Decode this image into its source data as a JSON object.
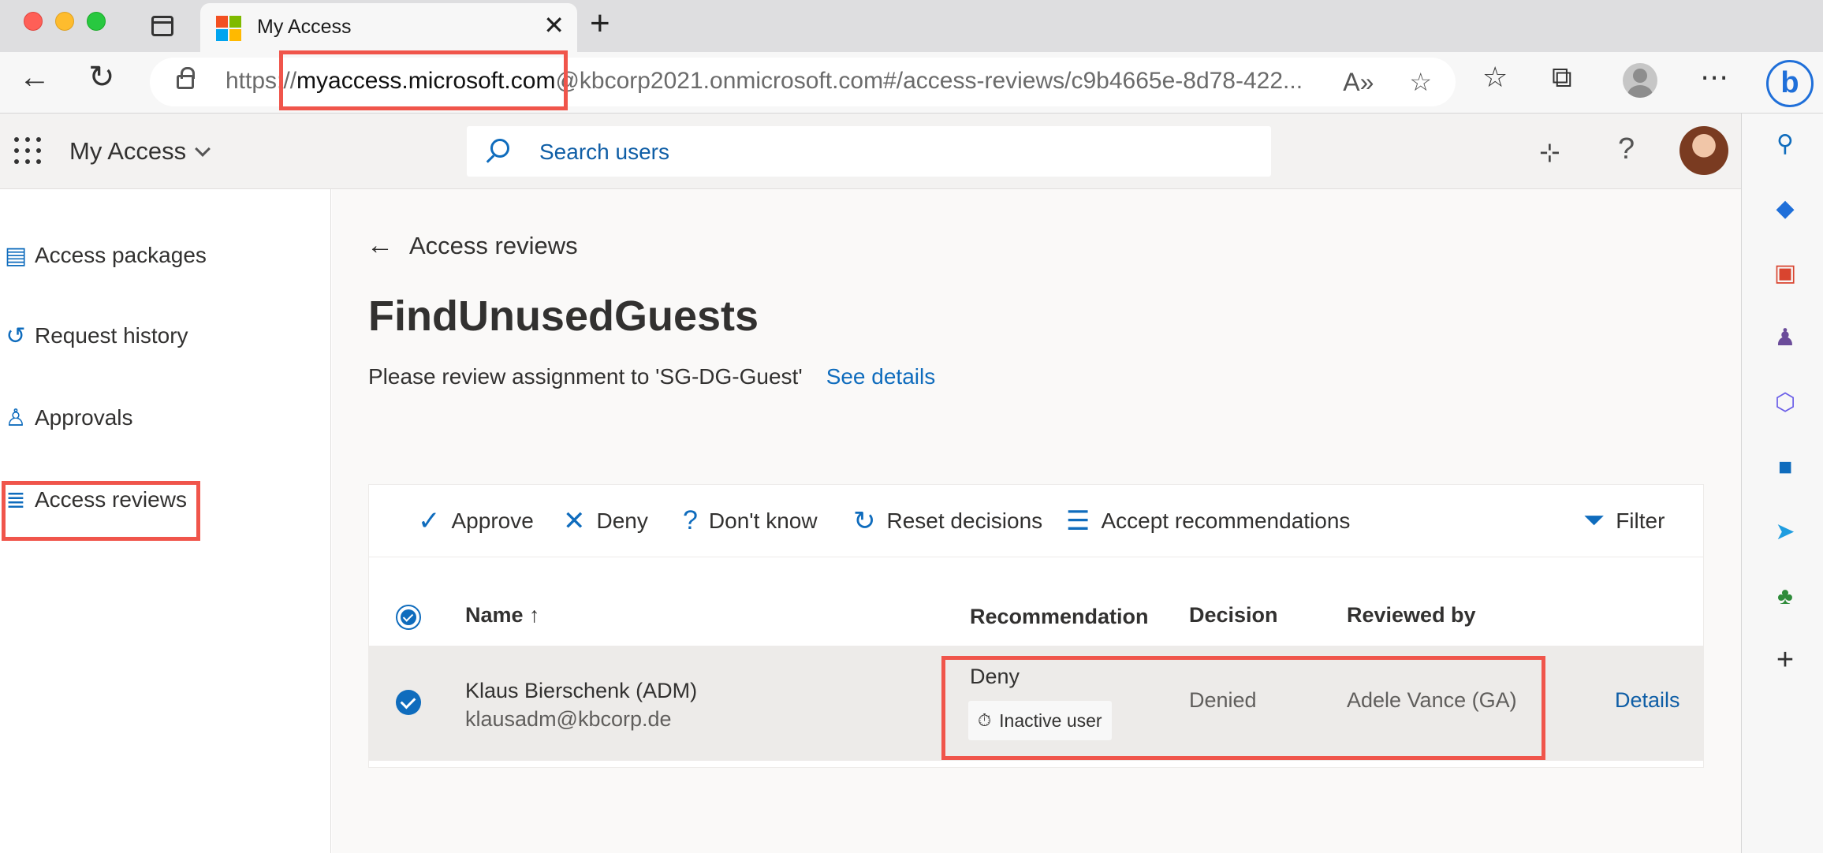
{
  "browser": {
    "tab_title": "My Access",
    "url_scheme": "https://",
    "url_host": "myaccess.microsoft.com",
    "url_rest": "@kbcorp2021.onmicrosoft.com#/access-reviews/c9b4665e-8d78-422...",
    "new_tab_glyph": "+",
    "close_glyph": "✕"
  },
  "app": {
    "title": "My Access",
    "search_placeholder": "Search users",
    "help_glyph": "?"
  },
  "nav": {
    "items": [
      {
        "label": "Access packages",
        "icon": "package-icon"
      },
      {
        "label": "Request history",
        "icon": "history-icon"
      },
      {
        "label": "Approvals",
        "icon": "approvals-icon"
      },
      {
        "label": "Access reviews",
        "icon": "list-icon",
        "selected": true
      }
    ]
  },
  "main": {
    "back_label": "Access reviews",
    "title": "FindUnusedGuests",
    "description": "Please review assignment to 'SG-DG-Guest'",
    "see_details": "See details"
  },
  "commands": {
    "approve": "Approve",
    "deny": "Deny",
    "dont_know": "Don't know",
    "reset": "Reset decisions",
    "accept": "Accept recommendations",
    "filter": "Filter"
  },
  "table": {
    "headers": {
      "name": "Name ↑",
      "recommendation": "Recommendation",
      "decision": "Decision",
      "reviewed_by": "Reviewed by"
    },
    "rows": [
      {
        "name": "Klaus Bierschenk (ADM)",
        "email": "klausadm@kbcorp.de",
        "recommendation": "Deny",
        "reason": "Inactive user",
        "decision": "Denied",
        "reviewed_by": "Adele Vance (GA)",
        "details": "Details",
        "selected": true
      }
    ]
  },
  "colors": {
    "accent": "#0f6cbd",
    "highlight": "#f0554b"
  }
}
